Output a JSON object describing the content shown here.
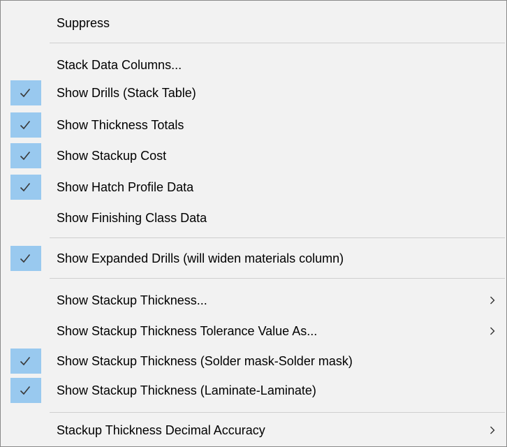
{
  "menu": {
    "items": [
      {
        "label": "Suppress",
        "checked": false,
        "submenu": false
      },
      {
        "label": "Stack Data Columns...",
        "checked": false,
        "submenu": false
      },
      {
        "label": "Show Drills (Stack Table)",
        "checked": true,
        "submenu": false
      },
      {
        "label": "Show Thickness Totals",
        "checked": true,
        "submenu": false
      },
      {
        "label": "Show Stackup Cost",
        "checked": true,
        "submenu": false
      },
      {
        "label": "Show Hatch Profile Data",
        "checked": true,
        "submenu": false
      },
      {
        "label": "Show Finishing Class Data",
        "checked": false,
        "submenu": false
      },
      {
        "label": "Show Expanded Drills (will widen materials column)",
        "checked": true,
        "submenu": false
      },
      {
        "label": "Show Stackup Thickness...",
        "checked": false,
        "submenu": true
      },
      {
        "label": "Show Stackup Thickness Tolerance Value As...",
        "checked": false,
        "submenu": true
      },
      {
        "label": "Show Stackup Thickness (Solder mask-Solder mask)",
        "checked": true,
        "submenu": false
      },
      {
        "label": "Show Stackup Thickness (Laminate-Laminate)",
        "checked": true,
        "submenu": false
      },
      {
        "label": "Stackup Thickness Decimal Accuracy",
        "checked": false,
        "submenu": true
      }
    ]
  },
  "colors": {
    "check_highlight": "#99c9ef",
    "menu_background": "#f2f2f2",
    "separator": "#cfcfcf"
  },
  "icons": {
    "check": "check-icon",
    "submenu": "chevron-right-icon"
  }
}
